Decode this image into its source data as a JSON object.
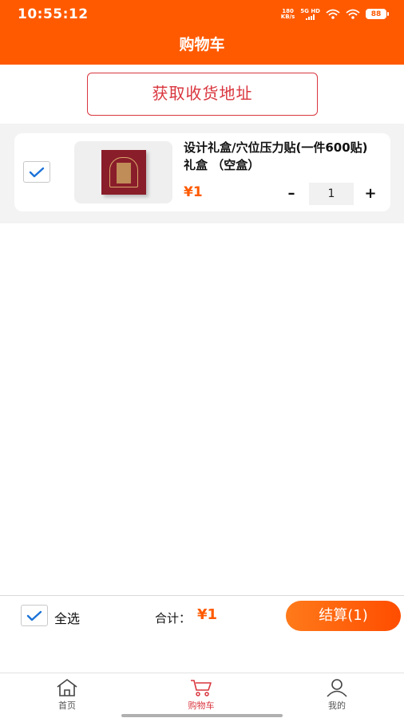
{
  "status_bar": {
    "time": "10:55:12",
    "net_speed_value": "180",
    "net_speed_unit": "KB/s",
    "signal_label": "5G HD",
    "battery": "88"
  },
  "header": {
    "title": "购物车"
  },
  "address_button": {
    "label": "获取收货地址"
  },
  "cart": {
    "items": [
      {
        "title": "设计礼盒/穴位压力贴(一件600贴) 礼盒 （空盒）",
        "price": "¥1",
        "quantity": "1",
        "checked": true,
        "minus_label": "–",
        "plus_label": "+"
      }
    ]
  },
  "bottom_bar": {
    "select_all_label": "全选",
    "total_label": "合计：",
    "total_value": "¥1",
    "checkout_label": "结算(1)"
  },
  "tabs": [
    {
      "label": "首页",
      "icon": "home-icon",
      "active": false
    },
    {
      "label": "购物车",
      "icon": "cart-icon",
      "active": true
    },
    {
      "label": "我的",
      "icon": "user-icon",
      "active": false
    }
  ],
  "colors": {
    "brand": "#ff5a00",
    "accent_red": "#d9363e",
    "check_blue": "#1b73d9"
  }
}
